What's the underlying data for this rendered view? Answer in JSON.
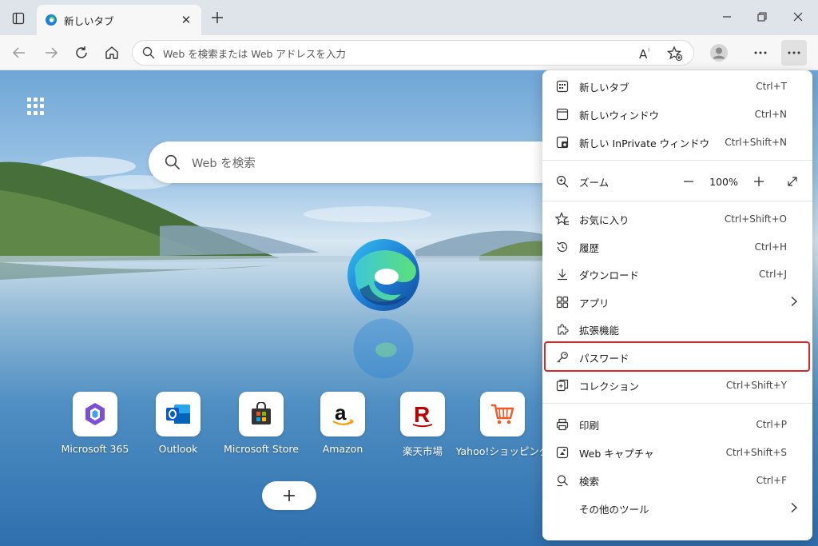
{
  "tab": {
    "title": "新しいタブ"
  },
  "address_bar": {
    "placeholder": "Web を検索または Web アドレスを入力"
  },
  "page": {
    "search_placeholder": "Web を検索",
    "quick_links": [
      {
        "label": "Microsoft 365"
      },
      {
        "label": "Outlook"
      },
      {
        "label": "Microsoft Store"
      },
      {
        "label": "Amazon"
      },
      {
        "label": "楽天市場"
      },
      {
        "label": "Yahoo!ショッピング"
      }
    ],
    "add_shortcut": "+"
  },
  "menu": {
    "new_tab": {
      "label": "新しいタブ",
      "shortcut": "Ctrl+T"
    },
    "new_window": {
      "label": "新しいウィンドウ",
      "shortcut": "Ctrl+N"
    },
    "new_inprivate": {
      "label": "新しい InPrivate ウィンドウ",
      "shortcut": "Ctrl+Shift+N"
    },
    "zoom": {
      "label": "ズーム",
      "value": "100%"
    },
    "favorites": {
      "label": "お気に入り",
      "shortcut": "Ctrl+Shift+O"
    },
    "history": {
      "label": "履歴",
      "shortcut": "Ctrl+H"
    },
    "downloads": {
      "label": "ダウンロード",
      "shortcut": "Ctrl+J"
    },
    "apps": {
      "label": "アプリ"
    },
    "extensions": {
      "label": "拡張機能"
    },
    "passwords": {
      "label": "パスワード"
    },
    "collections": {
      "label": "コレクション",
      "shortcut": "Ctrl+Shift+Y"
    },
    "print": {
      "label": "印刷",
      "shortcut": "Ctrl+P"
    },
    "web_capture": {
      "label": "Web キャプチャ",
      "shortcut": "Ctrl+Shift+S"
    },
    "find": {
      "label": "検索",
      "shortcut": "Ctrl+F"
    },
    "more_tools": {
      "label": "その他のツール"
    }
  },
  "colors": {
    "highlight": "#e02424",
    "edge_blue": "#1f7fd6",
    "edge_green": "#4fd07a"
  }
}
